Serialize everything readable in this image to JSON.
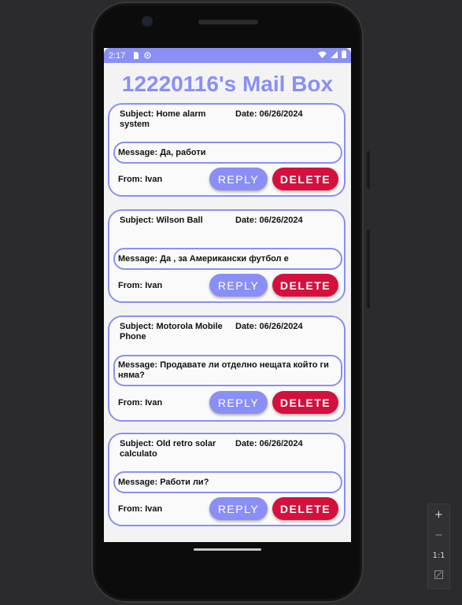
{
  "status_bar": {
    "time": "2:17"
  },
  "app": {
    "title": "12220116's Mail Box"
  },
  "messages": [
    {
      "subject": "Subject: Home alarm system",
      "date": "Date: 06/26/2024",
      "message": "Message: Да, работи",
      "from": "From: Ivan"
    },
    {
      "subject": "Subject: Wilson Ball",
      "date": "Date: 06/26/2024",
      "message": "Message: Да , за Американски футбол е",
      "from": "From: Ivan"
    },
    {
      "subject": "Subject: Motorola Mobile Phone",
      "date": "Date: 06/26/2024",
      "message": "Message: Продавате ли отделно нещата който ги няма?",
      "from": "From: Ivan"
    },
    {
      "subject": "Subject: Old retro solar calculato",
      "date": "Date: 06/26/2024",
      "message": "Message: Работи ли?",
      "from": "From: Ivan"
    }
  ],
  "buttons": {
    "reply": "REPLY",
    "delete": "DELETE"
  },
  "zoom_controls": {
    "plus": "+",
    "minus": "−",
    "one_to_one": "1:1"
  },
  "colors": {
    "accent": "#8a8ff5",
    "delete": "#d4113e",
    "background": "#f3f3f3"
  }
}
